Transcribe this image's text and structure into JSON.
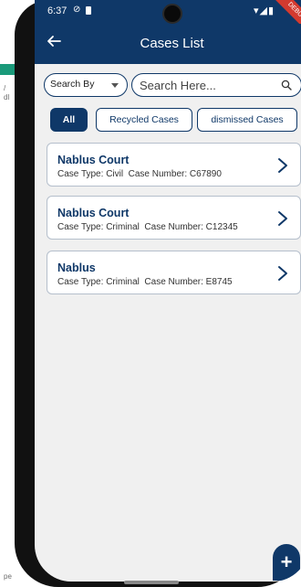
{
  "status_bar": {
    "time": "6:37",
    "icons_right": "▾◢▮",
    "debug_banner": "DEBUG"
  },
  "app_bar": {
    "title": "Cases List"
  },
  "search": {
    "search_by_label": "Search By",
    "placeholder": "Search Here..."
  },
  "filters": [
    {
      "label": "All",
      "active": true
    },
    {
      "label": "Recycled Cases",
      "active": false
    },
    {
      "label": "dismissed Cases",
      "active": false
    }
  ],
  "cases": [
    {
      "court": "Nablus Court",
      "case_type_label": "Case Type:",
      "case_type": "Civil",
      "case_number_label": "Case Number:",
      "case_number": "C67890"
    },
    {
      "court": "Nablus Court",
      "case_type_label": "Case Type:",
      "case_type": "Criminal",
      "case_number_label": "Case Number:",
      "case_number": "C12345"
    },
    {
      "court": "Nablus",
      "case_type_label": "Case Type:",
      "case_type": "Criminal",
      "case_number_label": "Case Number:",
      "case_number": "E8745"
    }
  ],
  "fab": {
    "label": "+"
  },
  "colors": {
    "primary": "#0f3868",
    "background": "#f0f0f0",
    "card_border": "#b5bfcc",
    "debug": "#d33a2f"
  },
  "icons": {
    "back": "arrow-left-icon",
    "search": "search-icon",
    "chevron": "chevron-right-icon",
    "caret": "caret-down-icon"
  }
}
